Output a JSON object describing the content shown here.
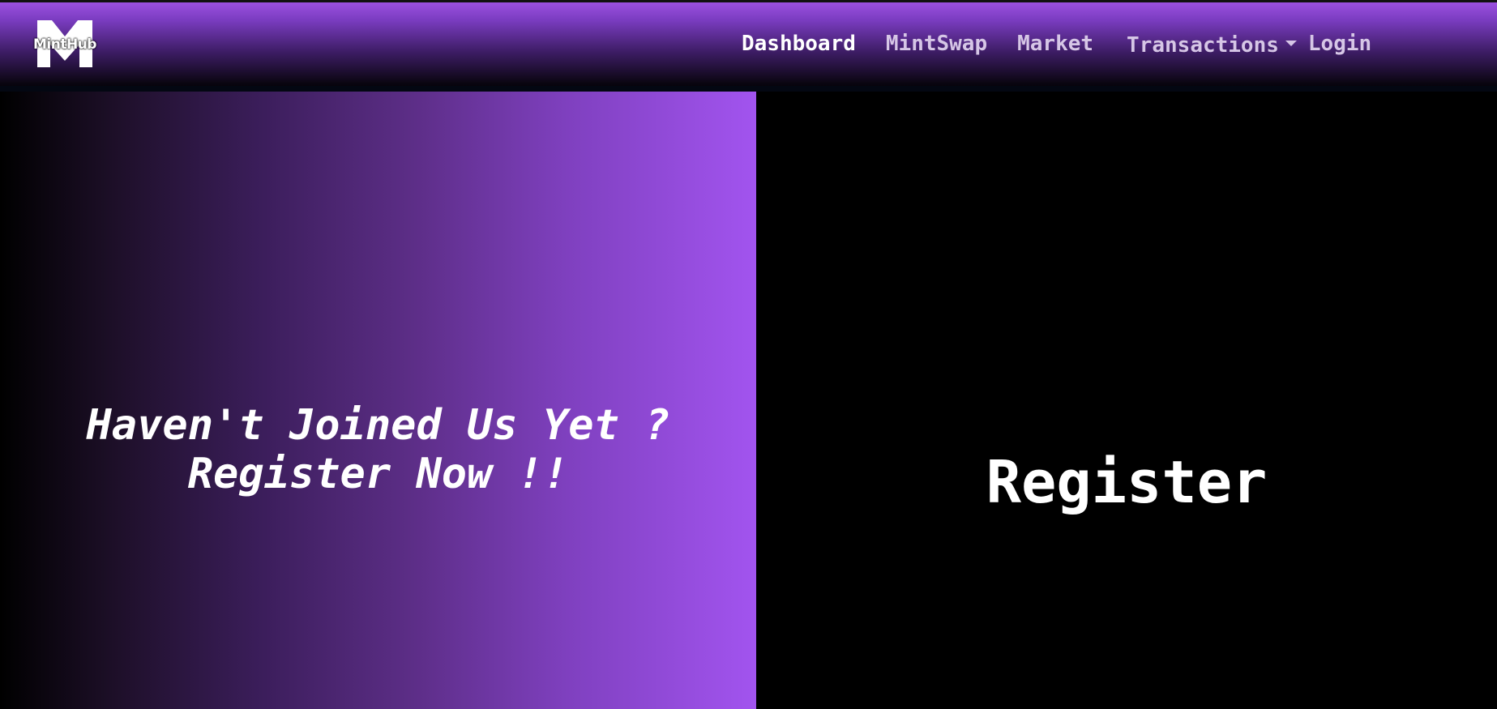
{
  "brand": {
    "name": "MintHub",
    "logo_icon": "m-letter-logo"
  },
  "nav": {
    "items": [
      {
        "label": "Dashboard",
        "active": true
      },
      {
        "label": "MintSwap",
        "active": false
      },
      {
        "label": "Market",
        "active": false
      },
      {
        "label": "Transactions",
        "active": false,
        "dropdown": true
      },
      {
        "label": "Login",
        "active": false
      }
    ]
  },
  "hero": {
    "line1": "Haven't Joined Us Yet ?",
    "line2": "Register Now !!"
  },
  "register": {
    "title": "Register"
  },
  "colors": {
    "accent": "#a254ef",
    "nav_text": "#d6c6e6",
    "background": "#000000"
  }
}
